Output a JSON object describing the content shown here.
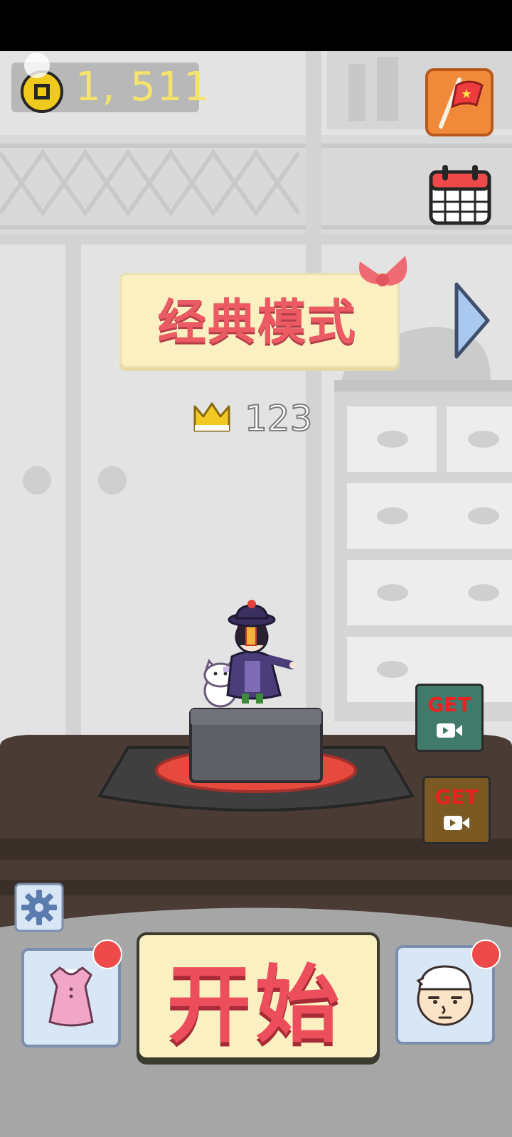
{
  "hud": {
    "coins": "1, 511"
  },
  "mode": {
    "title": "经典模式"
  },
  "best": {
    "score": "123"
  },
  "buttons": {
    "start_label": "开始",
    "get_label_1": "GET",
    "get_label_2": "GET"
  },
  "icons": {
    "coin": "coin-icon",
    "flag": "flag-icon",
    "calendar": "calendar-icon",
    "next": "next-arrow-icon",
    "crown": "crown-icon",
    "settings": "gear-icon",
    "outfit": "dress-icon",
    "character": "character-face-icon",
    "video": "video-camera-icon"
  },
  "colors": {
    "coin_text": "#f6e36a",
    "mode_text": "#ec5a64",
    "start_text": "#ec4e5c",
    "notification_dot": "#ee4a4a",
    "get_text": "#ee2020"
  }
}
